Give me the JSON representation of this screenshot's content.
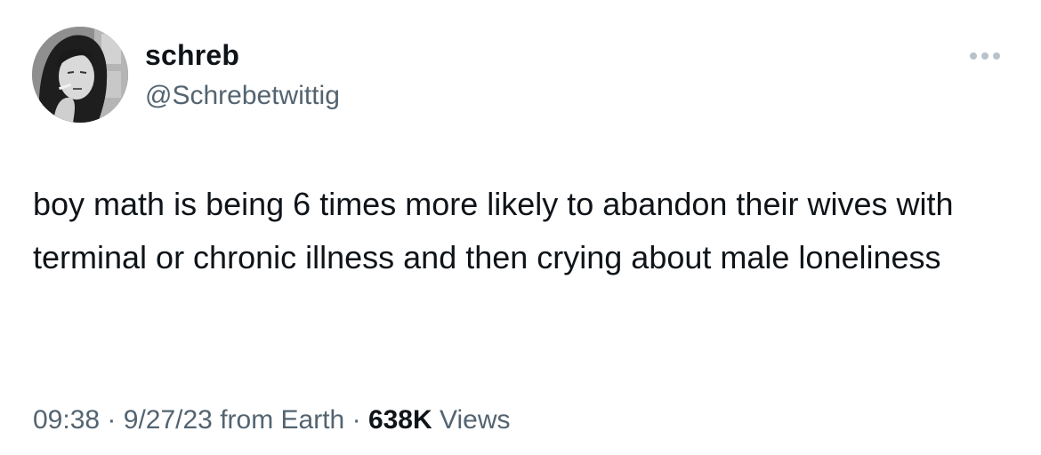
{
  "author": {
    "display_name": "schreb",
    "handle": "@Schrebetwittig",
    "avatar_icon": "user-avatar-photo"
  },
  "menu": {
    "more_icon": "more-horizontal-icon"
  },
  "tweet": {
    "text": "boy math is being 6 times more likely to abandon their wives with terminal or chronic illness and then crying about male loneliness"
  },
  "meta": {
    "time": "09:38",
    "separator": "·",
    "date": "9/27/23",
    "source": "from Earth",
    "views_count": "638K",
    "views_label": "Views"
  },
  "colors": {
    "text_primary": "#0f1419",
    "text_secondary": "#536471",
    "background": "#ffffff"
  }
}
